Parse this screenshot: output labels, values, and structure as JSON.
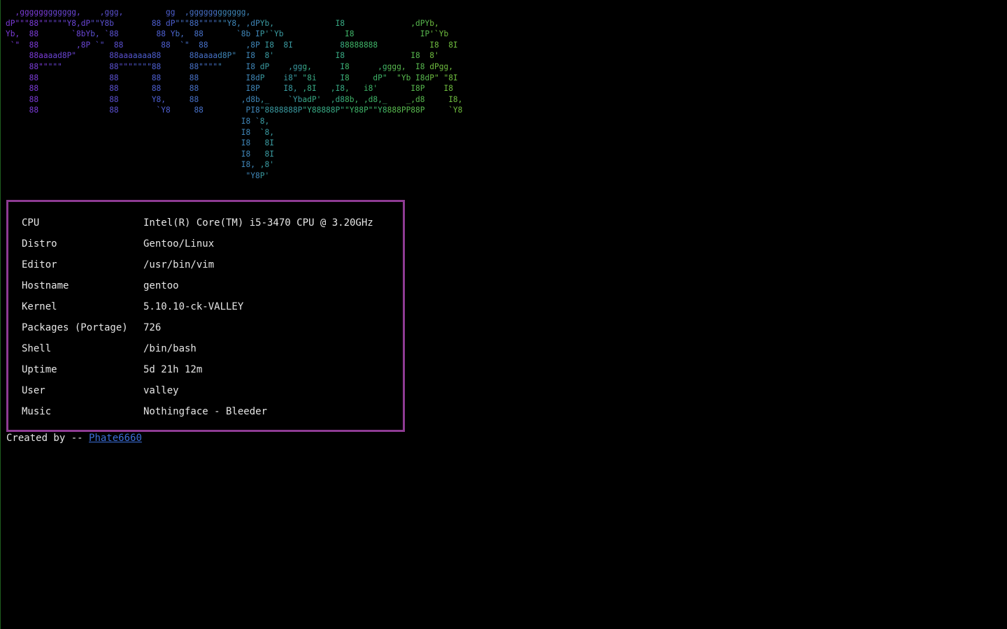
{
  "banner": {
    "lines": [
      "  ,gggggggggggg,    ,ggg,         gg  ,gggggggggggg,",
      "dP\"\"\"88\"\"\"\"\"\"Y8,dP\"\"Y8b        88 dP\"\"\"88\"\"\"\"\"\"Y8, ,dPYb,             I8              ,dPYb,",
      "Yb,  88       `8bYb, `88        88 Yb,  88       `8b IP'`Yb             I8              IP'`Yb",
      " `\"  88        ,8P `\"  88        88  `\"  88        ,8P I8  8I          88888888           I8  8I",
      "     88aaaad8P\"       88aaaaaaa88      88aaaad8P\"  I8  8'             I8              I8  8'",
      "     88\"\"\"\"\"          88\"\"\"\"\"\"\"88      88\"\"\"\"\"     I8 dP    ,ggg,      I8      ,gggg,  I8 dPgg,",
      "     88               88       88      88          I8dP    i8\" \"8i     I8     dP\"  \"Yb I8dP\" \"8I",
      "     88               88       88      88          I8P     I8, ,8I   ,I8,   i8'       I8P    I8",
      "     88               88       Y8,     88         ,d8b,_    `YbadP'  ,d88b, ,d8,_    _,d8     I8,",
      "     88               88        `Y8     88         PI8\"8888888P\"Y88888P\"\"Y88P\"\"Y8888PP88P     `Y8",
      "                                                  I8 `8,",
      "                                                  I8  `8,",
      "                                                  I8   8I",
      "                                                  I8   8I",
      "                                                  I8, ,8'",
      "                                                   \"Y8P'"
    ],
    "colors": [
      "#7a3bd6",
      "#6a45d4",
      "#5a50cf",
      "#4e5fd0",
      "#4770c7",
      "#3f86b8",
      "#3a9aa0",
      "#38aa84",
      "#3fb468",
      "#57b84e",
      "#6fbd3f",
      "#86c23a"
    ]
  },
  "info": {
    "rows": [
      {
        "key": "CPU",
        "value": "Intel(R) Core(TM) i5-3470 CPU @ 3.20GHz"
      },
      {
        "key": "Distro",
        "value": "Gentoo/Linux"
      },
      {
        "key": "Editor",
        "value": "/usr/bin/vim"
      },
      {
        "key": "Hostname",
        "value": "gentoo"
      },
      {
        "key": "Kernel",
        "value": "5.10.10-ck-VALLEY"
      },
      {
        "key": "Packages (Portage)",
        "value": "726"
      },
      {
        "key": "Shell",
        "value": "/bin/bash"
      },
      {
        "key": "Uptime",
        "value": "5d 21h 12m"
      },
      {
        "key": "User",
        "value": "valley"
      },
      {
        "key": "Music",
        "value": "Nothingface - Bleeder"
      }
    ],
    "border_color": "#8e3b93"
  },
  "footer": {
    "prefix": "Created by -- ",
    "link_text": "Phate6660",
    "link_color": "#3c6fd9"
  }
}
